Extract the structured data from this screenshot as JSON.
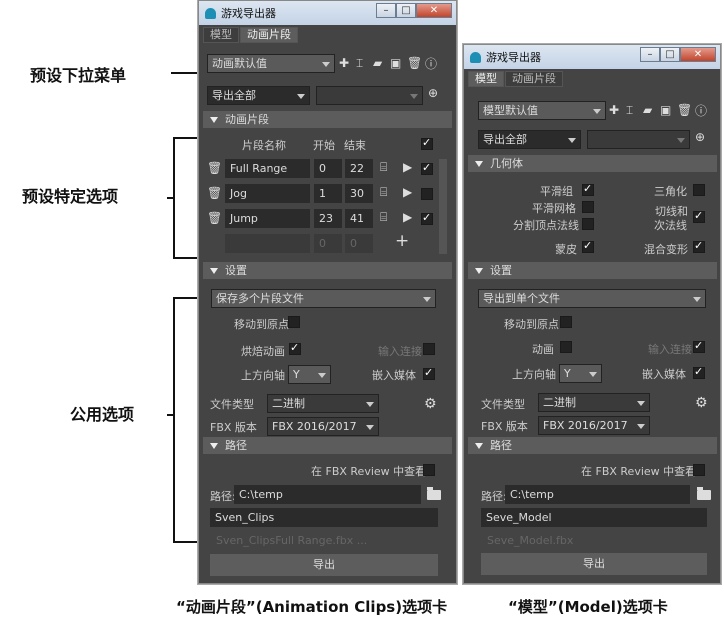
{
  "callouts": {
    "preset_dropdown": "预设下拉菜单",
    "preset_specific": "预设特定选项",
    "common": "公用选项"
  },
  "captions": {
    "left": "“动画片段”(Animation Clips)选项卡",
    "right": "“模型”(Model)选项卡"
  },
  "left": {
    "title": "游戏导出器",
    "tabs": [
      "模型",
      "动画片段"
    ],
    "preset": "动画默认值",
    "export_mode": "导出全部",
    "sections": {
      "clips": "动画片段",
      "settings": "设置",
      "path": "路径"
    },
    "headers": {
      "name": "片段名称",
      "start": "开始",
      "end": "结束"
    },
    "clips": [
      {
        "name": "Full Range",
        "start": "0",
        "end": "22",
        "checked": true
      },
      {
        "name": "Jog",
        "start": "1",
        "end": "30",
        "checked": false
      },
      {
        "name": "Jump",
        "start": "23",
        "end": "41",
        "checked": true
      }
    ],
    "empty_row": {
      "start": "0",
      "end": "0"
    },
    "save_mode": "保存多个片段文件",
    "move_origin": "移动到原点",
    "bake": "烘焙动画",
    "input_conn": "输入连接",
    "up_axis_label": "上方向轴",
    "up_axis": "Y",
    "embed_media": "嵌入媒体",
    "file_type_label": "文件类型",
    "file_type": "二进制",
    "fbx_version_label": "FBX 版本",
    "fbx_version": "FBX 2016/2017",
    "review": "在 FBX Review 中查看",
    "path_label": "路径:",
    "path": "C:\\temp",
    "filename": "Sven_Clips",
    "filename_preview": "Sven_ClipsFull Range.fbx ...",
    "export": "导出"
  },
  "right": {
    "title": "游戏导出器",
    "tabs": [
      "模型",
      "动画片段"
    ],
    "preset": "模型默认值",
    "export_mode": "导出全部",
    "sections": {
      "geometry": "几何体",
      "settings": "设置",
      "path": "路径"
    },
    "smooth_groups": "平滑组",
    "triangulate": "三角化",
    "smooth_mesh": "平滑网格",
    "tangents": "切线和",
    "binormals": "次法线",
    "split_normals": "分割顶点法线",
    "skin": "蒙皮",
    "blendshapes": "混合变形",
    "export_mode2": "导出到单个文件",
    "move_origin": "移动到原点",
    "anim": "动画",
    "input_conn": "输入连接",
    "up_axis_label": "上方向轴",
    "up_axis": "Y",
    "embed_media": "嵌入媒体",
    "file_type_label": "文件类型",
    "file_type": "二进制",
    "fbx_version_label": "FBX 版本",
    "fbx_version": "FBX 2016/2017",
    "review": "在 FBX Review 中查看",
    "path_label": "路径:",
    "path": "C:\\temp",
    "filename": "Seve_Model",
    "filename_preview": "Seve_Model.fbx",
    "export": "导出"
  }
}
